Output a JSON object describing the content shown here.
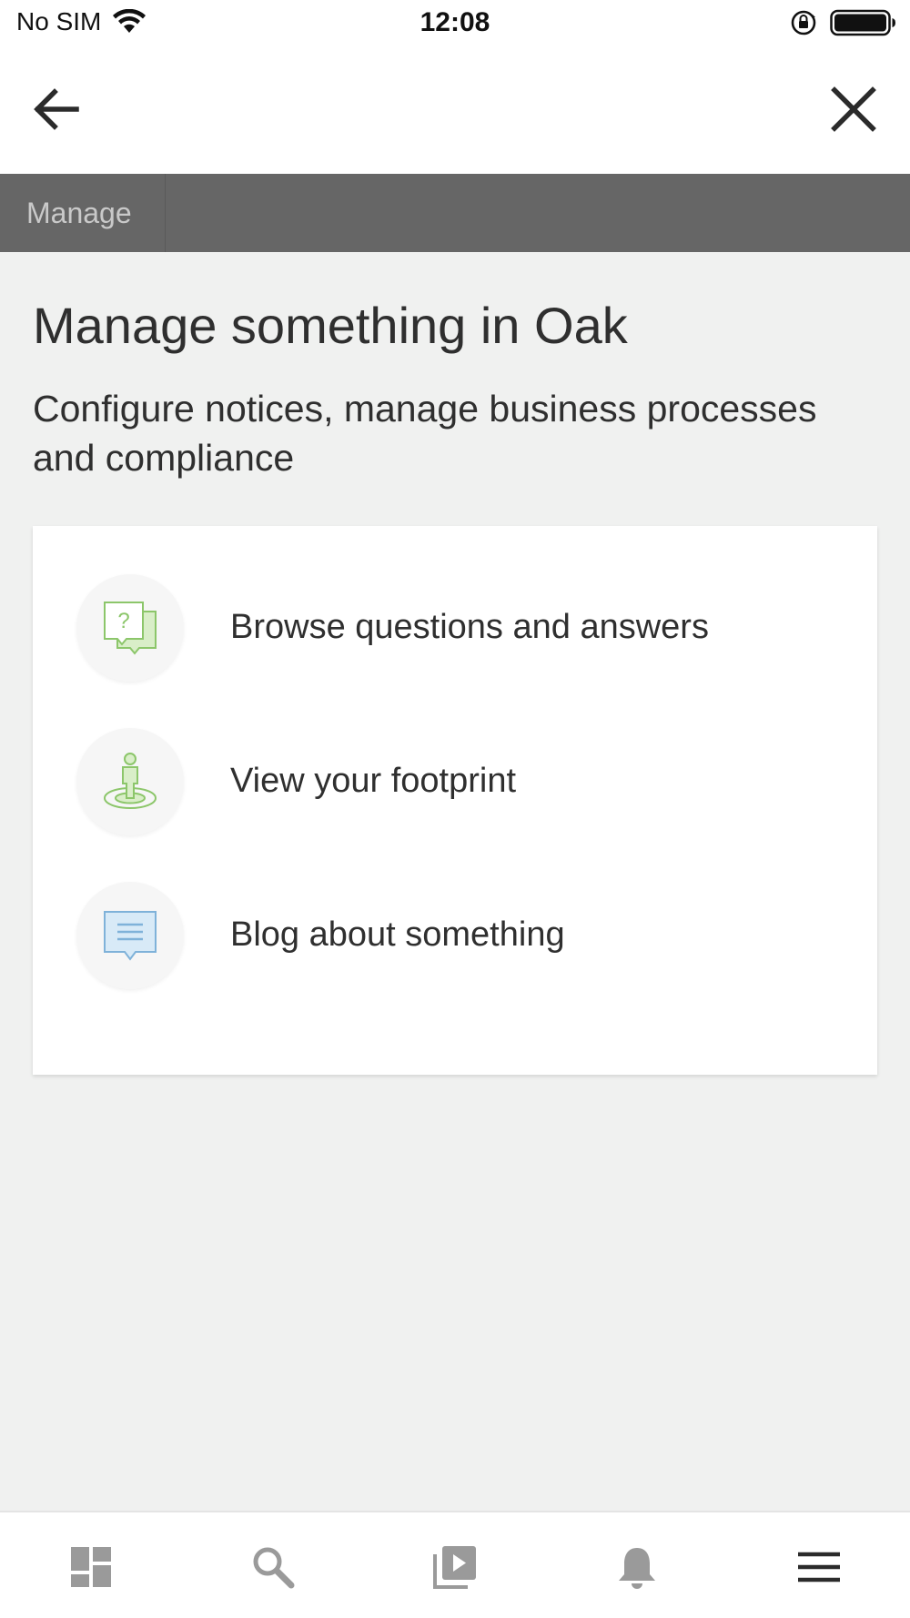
{
  "status_bar": {
    "carrier": "No SIM",
    "time": "12:08"
  },
  "nav": {
    "back_icon": "arrow-left-icon",
    "close_icon": "close-icon"
  },
  "tabs": [
    {
      "label": "Manage"
    }
  ],
  "page": {
    "title": "Manage something in Oak",
    "subtitle": "Configure notices, manage business processes and compliance"
  },
  "card": {
    "items": [
      {
        "label": "Browse questions and answers",
        "icon": "question-bubbles-icon"
      },
      {
        "label": "View your footprint",
        "icon": "person-footprint-icon"
      },
      {
        "label": "Blog about something",
        "icon": "blog-bubble-icon"
      }
    ]
  },
  "bottom_nav": {
    "items": [
      {
        "icon": "dashboard-icon"
      },
      {
        "icon": "search-icon"
      },
      {
        "icon": "media-library-icon"
      },
      {
        "icon": "bell-icon"
      },
      {
        "icon": "menu-icon"
      }
    ]
  },
  "colors": {
    "tab_bar_bg": "#666666",
    "page_bg": "#f0f1f0",
    "icon_green": "#8cc66a",
    "icon_blue": "#7fb2d9",
    "bottom_icon": "#9a9a9a"
  }
}
